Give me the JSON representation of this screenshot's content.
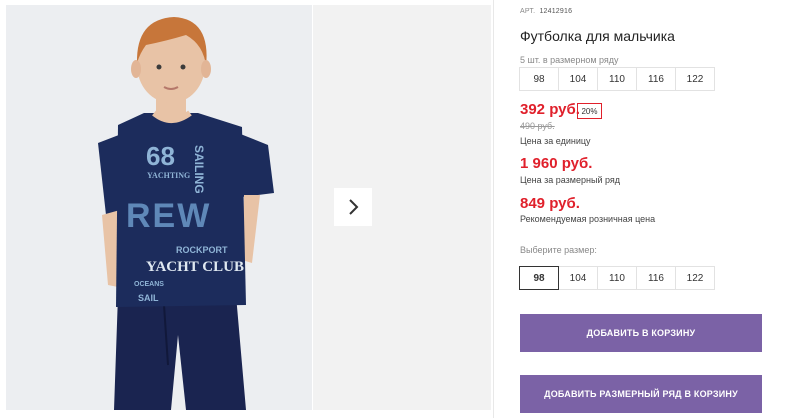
{
  "product": {
    "sku_label": "АРТ.",
    "sku_value": "12412916",
    "title": "Футболка для мальчика",
    "pack_note": "5 шт. в размерном ряду",
    "pack_sizes": [
      "98",
      "104",
      "110",
      "116",
      "122"
    ],
    "price": "392 руб.",
    "discount": "20%",
    "old_price": "490 руб.",
    "unit_note": "Цена за единицу",
    "pack_price": "1 960 руб.",
    "pack_price_note": "Цена за размерный ряд",
    "rrp_price": "849 руб.",
    "rrp_note": "Рекомендуемая розничная цена",
    "choose_size_label": "Выберите размер:",
    "select_sizes": [
      "98",
      "104",
      "110",
      "116",
      "122"
    ],
    "selected_size": "98",
    "add_to_cart_label": "ДОБАВИТЬ В КОРЗИНУ",
    "add_pack_label": "ДОБАВИТЬ РАЗМЕРНЫЙ РЯД В КОРЗИНУ"
  },
  "photo": {
    "tee_prints": [
      "68",
      "YACHTING",
      "SAILING",
      "REW",
      "YACHT CLUB",
      "ROCKPORT",
      "SAIL",
      "OCEANS"
    ]
  },
  "gallery": {
    "next_icon": "chevron-right-icon"
  },
  "colors": {
    "price_red": "#e0202b",
    "button_purple": "#7b62a6",
    "tee_navy": "#1c2c5c",
    "pants_navy": "#1a2450"
  }
}
